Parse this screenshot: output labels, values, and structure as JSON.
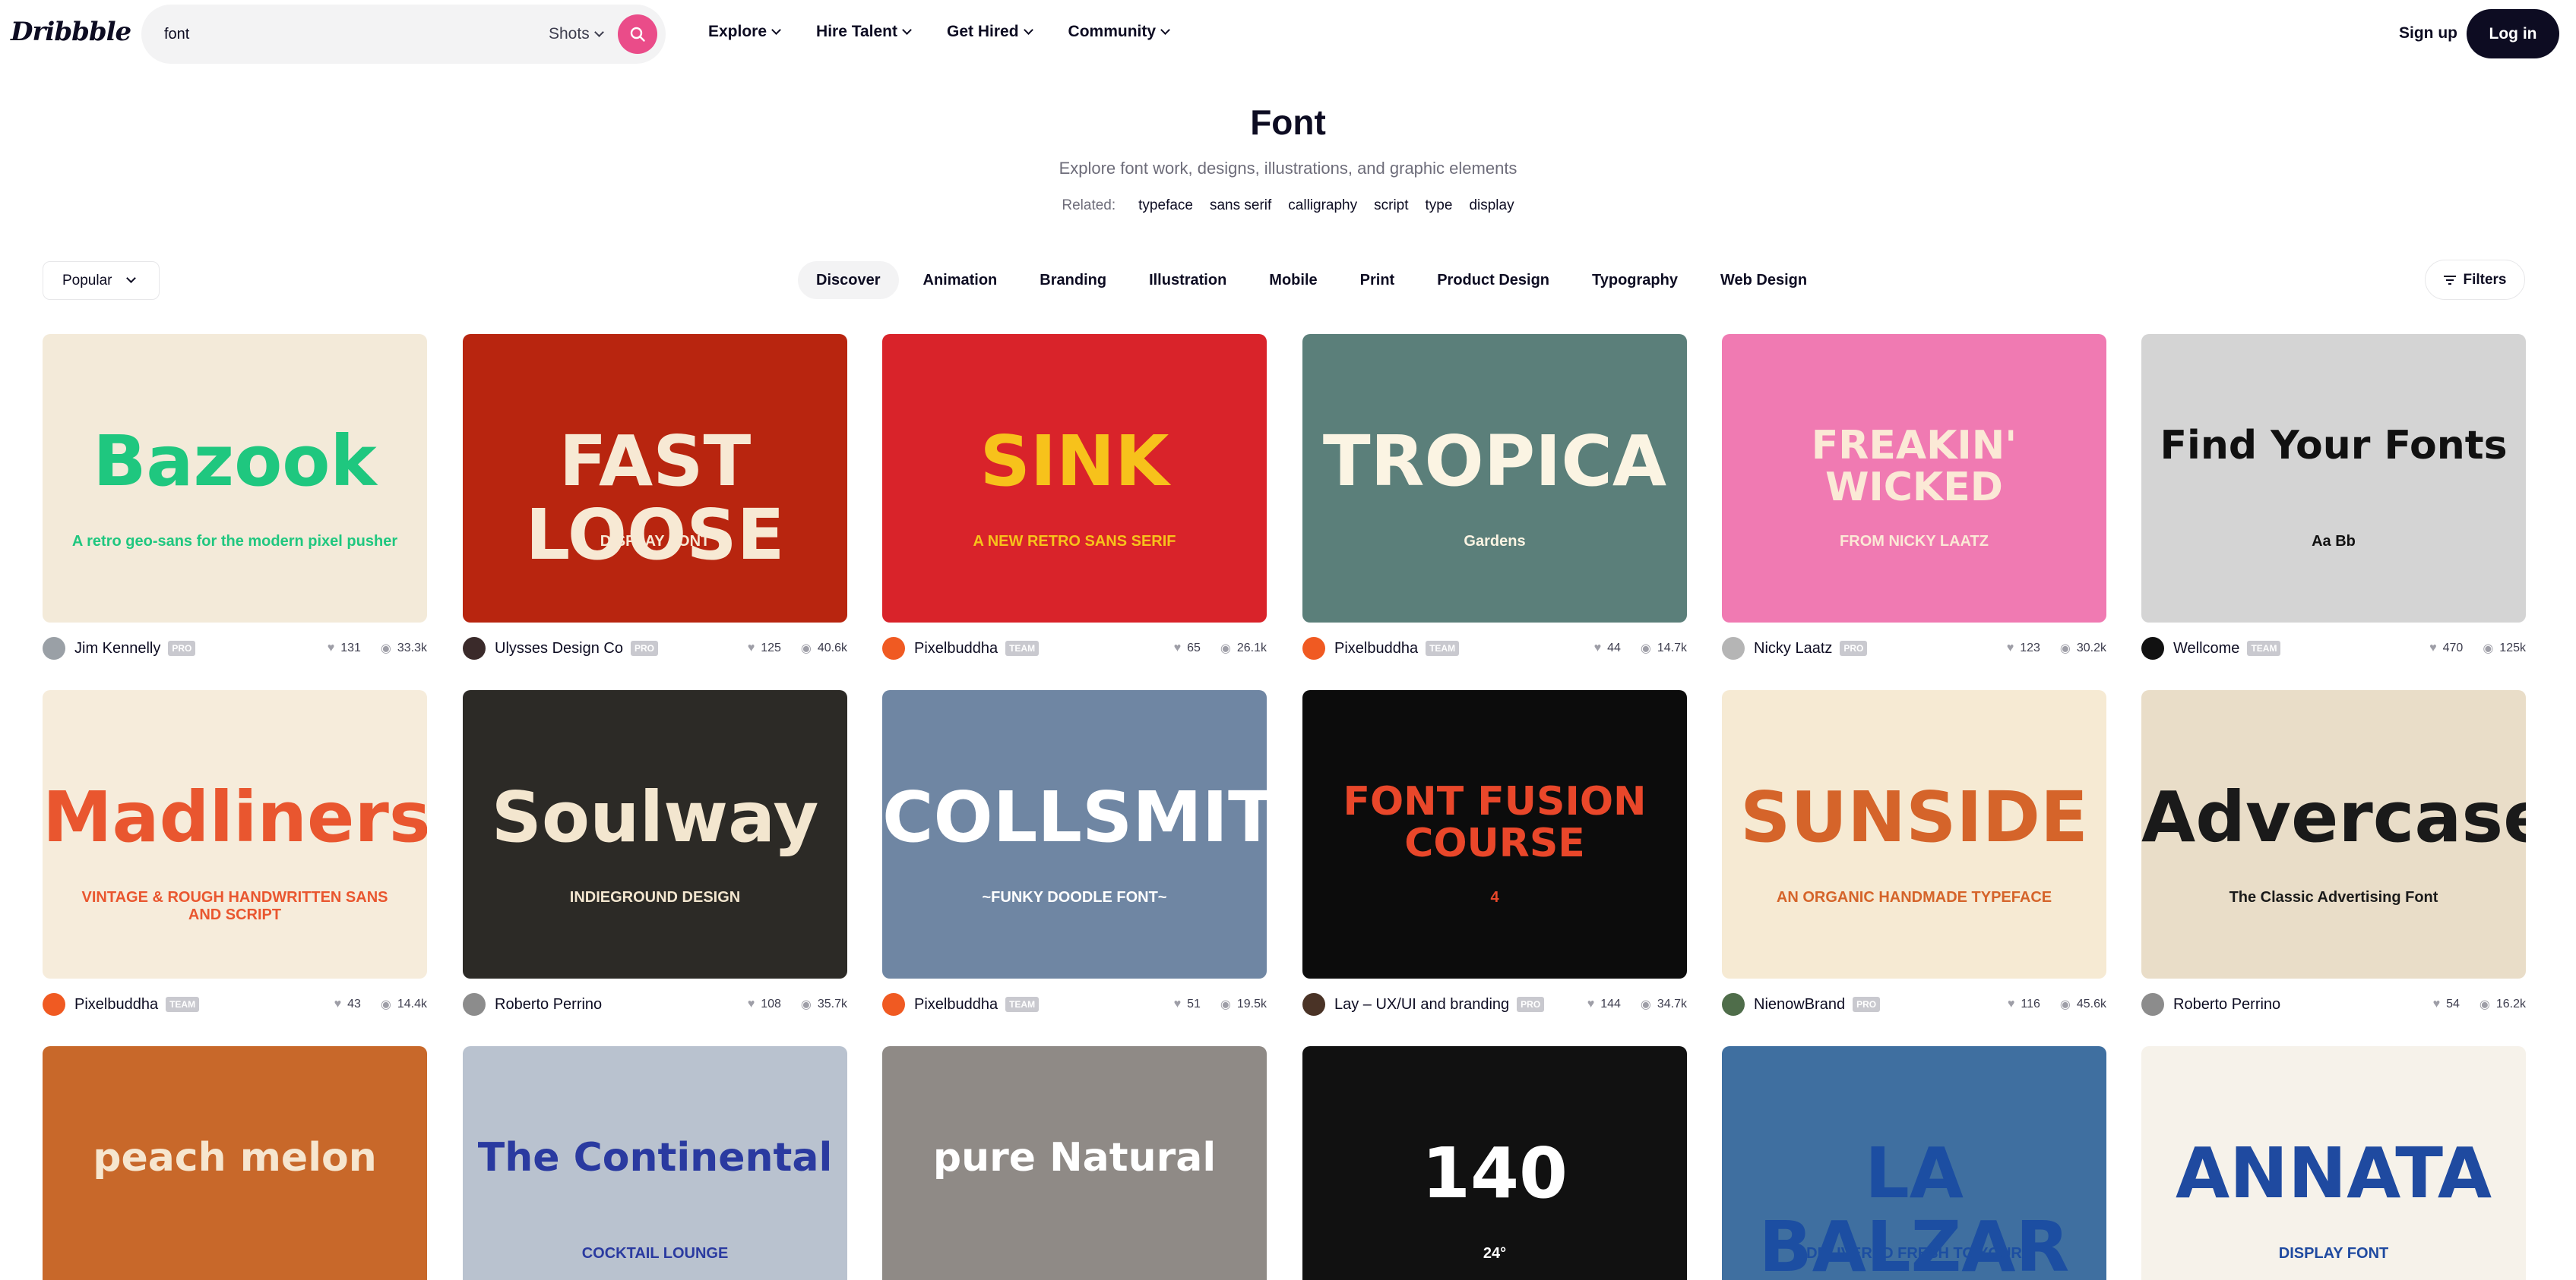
{
  "header": {
    "logo": "Dribbble",
    "search_value": "font",
    "search_scope": "Shots",
    "nav": [
      "Explore",
      "Hire Talent",
      "Get Hired",
      "Community"
    ],
    "signup": "Sign up",
    "login": "Log in"
  },
  "hero": {
    "title": "Font",
    "subtitle": "Explore font work, designs, illustrations, and graphic elements",
    "related_label": "Related:",
    "related": [
      "typeface",
      "sans serif",
      "calligraphy",
      "script",
      "type",
      "display"
    ]
  },
  "filters": {
    "sort": "Popular",
    "categories": [
      "Discover",
      "Animation",
      "Branding",
      "Illustration",
      "Mobile",
      "Print",
      "Product Design",
      "Typography",
      "Web Design"
    ],
    "filters_label": "Filters"
  },
  "shots": [
    {
      "author": "Jim Kennelly",
      "badge": "PRO",
      "likes": "131",
      "views": "33.3k",
      "art": "Bazook",
      "art_sub": "A retro geo-sans for the modern pixel pusher",
      "bg": "#f3ead9",
      "fg": "#1fc77f",
      "avatar": "#9aa0a6"
    },
    {
      "author": "Ulysses Design Co",
      "badge": "PRO",
      "likes": "125",
      "views": "40.6k",
      "art": "FAST LOOSE",
      "art_sub": "DISPLAY FONT",
      "bg": "#b8250f",
      "fg": "#f7e9d4",
      "avatar": "#3a2a2a"
    },
    {
      "author": "Pixelbuddha",
      "badge": "TEAM",
      "likes": "65",
      "views": "26.1k",
      "art": "SINK",
      "art_sub": "A NEW RETRO SANS SERIF",
      "bg": "#d9232a",
      "fg": "#f7c21b",
      "avatar": "#f05a22"
    },
    {
      "author": "Pixelbuddha",
      "badge": "TEAM",
      "likes": "44",
      "views": "14.7k",
      "art": "TROPICA",
      "art_sub": "Gardens",
      "bg": "#5b7f7a",
      "fg": "#fbf4e3",
      "avatar": "#f05a22"
    },
    {
      "author": "Nicky Laatz",
      "badge": "PRO",
      "likes": "123",
      "views": "30.2k",
      "art": "FREAKIN' WICKED",
      "art_sub": "FROM NICKY LAATZ",
      "bg": "#f07ab2",
      "fg": "#fbe9d6",
      "avatar": "#b5b5b5"
    },
    {
      "author": "Wellcome",
      "badge": "TEAM",
      "likes": "470",
      "views": "125k",
      "art": "Find Your Fonts",
      "art_sub": "Aa Bb",
      "bg": "#d4d4d4",
      "fg": "#111111",
      "avatar": "#111111"
    },
    {
      "author": "Pixelbuddha",
      "badge": "TEAM",
      "likes": "43",
      "views": "14.4k",
      "art": "Madliners",
      "art_sub": "VINTAGE & ROUGH HANDWRITTEN SANS AND SCRIPT",
      "bg": "#f6ecdb",
      "fg": "#e9562f",
      "avatar": "#f05a22"
    },
    {
      "author": "Roberto Perrino",
      "badge": "",
      "likes": "108",
      "views": "35.7k",
      "art": "Soulway",
      "art_sub": "INDIEGROUND DESIGN",
      "bg": "#2c2a26",
      "fg": "#f3e6cf",
      "avatar": "#8c8c8c"
    },
    {
      "author": "Pixelbuddha",
      "badge": "TEAM",
      "likes": "51",
      "views": "19.5k",
      "art": "COLLSMITH",
      "art_sub": "~FUNKY DOODLE FONT~",
      "bg": "#6f86a3",
      "fg": "#ffffff",
      "avatar": "#f05a22"
    },
    {
      "author": "Lay – UX/UI and branding",
      "badge": "PRO",
      "likes": "144",
      "views": "34.7k",
      "art": "FONT FUSION COURSE",
      "art_sub": "4",
      "bg": "#0c0c0c",
      "fg": "#e9472a",
      "avatar": "#4a3326"
    },
    {
      "author": "NienowBrand",
      "badge": "PRO",
      "likes": "116",
      "views": "45.6k",
      "art": "SUNSIDE",
      "art_sub": "AN ORGANIC HANDMADE TYPEFACE",
      "bg": "#f6ead3",
      "fg": "#d5642a",
      "avatar": "#4f6d4a"
    },
    {
      "author": "Roberto Perrino",
      "badge": "",
      "likes": "54",
      "views": "16.2k",
      "art": "Advercase",
      "art_sub": "The Classic Advertising Font",
      "bg": "#e9ddc8",
      "fg": "#1a1a1a",
      "avatar": "#8c8c8c"
    },
    {
      "author": "",
      "badge": "",
      "likes": "",
      "views": "",
      "art": "peach melon",
      "art_sub": "",
      "bg": "#c8682a",
      "fg": "#f6e6cf",
      "avatar": ""
    },
    {
      "author": "",
      "badge": "",
      "likes": "",
      "views": "",
      "art": "The Continental",
      "art_sub": "COCKTAIL LOUNGE",
      "bg": "#b9c2cf",
      "fg": "#2a3aa0",
      "avatar": ""
    },
    {
      "author": "",
      "badge": "",
      "likes": "",
      "views": "",
      "art": "pure Natural",
      "art_sub": "",
      "bg": "#8f8a86",
      "fg": "#ffffff",
      "avatar": ""
    },
    {
      "author": "",
      "badge": "",
      "likes": "",
      "views": "",
      "art": "140",
      "art_sub": "24°",
      "bg": "#111111",
      "fg": "#ffffff",
      "avatar": ""
    },
    {
      "author": "",
      "badge": "",
      "likes": "",
      "views": "",
      "art": "LA BALZAR",
      "art_sub": "DELIVERED FRESH TO YOUR",
      "bg": "#3f6fa0",
      "fg": "#1c4ea2",
      "avatar": ""
    },
    {
      "author": "",
      "badge": "",
      "likes": "",
      "views": "",
      "art": "ANNATA",
      "art_sub": "DISPLAY FONT",
      "bg": "#f6f2ea",
      "fg": "#1f4aa0",
      "avatar": ""
    }
  ]
}
